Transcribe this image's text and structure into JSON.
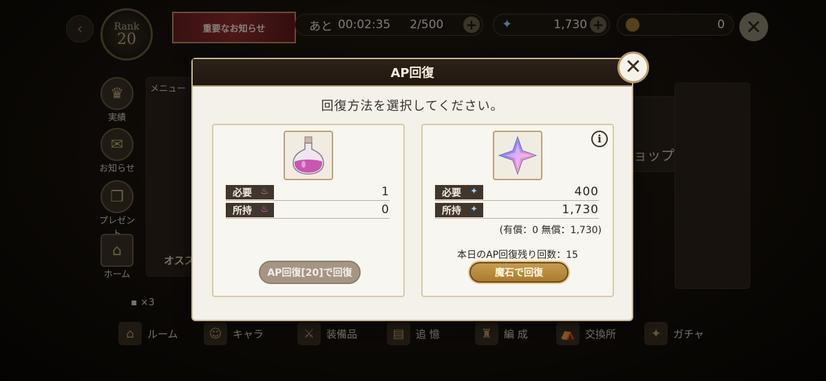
{
  "topbar": {
    "rank_label": "Rank",
    "rank_value": "20",
    "notice_label": "重要なお知らせ",
    "ap_timer_prefix": "あと",
    "ap_timer": "00:02:35",
    "ap_count": "2/500",
    "gem_count": "1,730",
    "coin_count": "0"
  },
  "sidebar": {
    "items": [
      {
        "label": "実績",
        "icon": "trophy-icon"
      },
      {
        "label": "お知らせ",
        "icon": "mail-icon"
      },
      {
        "label": "プレゼント",
        "icon": "gift-icon"
      },
      {
        "label": "ホーム",
        "icon": "home-icon"
      }
    ]
  },
  "background": {
    "menu_label": "メニュー",
    "osusume_label": "オスス",
    "shop_label": "ョップ",
    "chat_count": "×3"
  },
  "bottom_nav": {
    "items": [
      {
        "label": "ルーム",
        "icon": "door-icon"
      },
      {
        "label": "キャラ",
        "icon": "character-icon"
      },
      {
        "label": "装備品",
        "icon": "equipment-icon"
      },
      {
        "label": "追 憶",
        "icon": "memory-icon"
      },
      {
        "label": "編 成",
        "icon": "formation-icon"
      },
      {
        "label": "交換所",
        "icon": "exchange-icon"
      },
      {
        "label": "ガチャ",
        "icon": "gacha-icon"
      }
    ]
  },
  "modal": {
    "title": "AP回復",
    "instruction": "回復方法を選択してください。",
    "potion_option": {
      "required_label": "必要",
      "required_value": "1",
      "owned_label": "所持",
      "owned_value": "0",
      "button_label": "AP回復[20]で回復"
    },
    "gem_option": {
      "required_label": "必要",
      "required_value": "400",
      "owned_label": "所持",
      "owned_value": "1,730",
      "paid_note": "(有償：0 無償：1,730)",
      "remaining_label": "本日のAP回復残り回数：15",
      "button_label": "魔石で回復",
      "info_label": "i"
    }
  },
  "colors": {
    "modal_bg": "#f4f1ea",
    "header_bg": "#2e2218",
    "accent_gold": "#c79e53",
    "disabled_button": "#a59684",
    "label_dark": "#40362d"
  }
}
